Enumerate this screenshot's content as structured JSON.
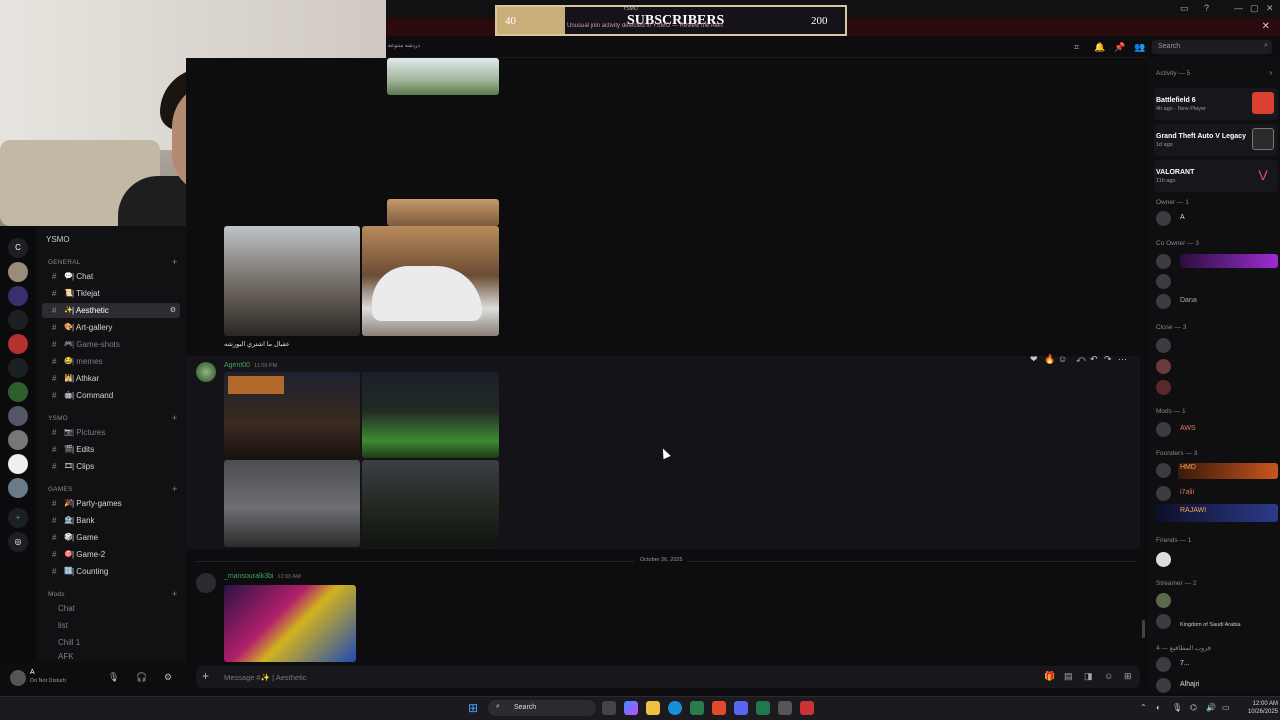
{
  "overlay": {
    "left_value": "40",
    "title": "SUBSCRIBERS",
    "right_value": "200",
    "subtitle": "Unusual join activity detected in YSMO — Review the Alert",
    "top_label": "YSMO"
  },
  "header": {
    "breadcrumb": "دردشة متنوعة",
    "search_placeholder": "Search"
  },
  "rail": {
    "home_letter": "C"
  },
  "server": {
    "name": "YSMO"
  },
  "categories": [
    {
      "label": "GENERAL"
    },
    {
      "label": "YSMO"
    },
    {
      "label": "GAMES"
    },
    {
      "label": "Mods"
    }
  ],
  "channels": [
    {
      "label": "| Chat",
      "emoji": "💬",
      "muted": false
    },
    {
      "label": "| Tklejat",
      "emoji": "📜",
      "muted": false
    },
    {
      "label": "| Aesthetic",
      "emoji": "✨",
      "muted": false,
      "active": true
    },
    {
      "label": "| Art-gallery",
      "emoji": "🎨",
      "muted": false
    },
    {
      "label": "| Game-shots",
      "emoji": "🎮",
      "muted": true
    },
    {
      "label": "| memes",
      "emoji": "😂",
      "muted": true
    },
    {
      "label": "| Athkar",
      "emoji": "🕌",
      "muted": false
    },
    {
      "label": "| Command",
      "emoji": "🤖",
      "muted": false
    },
    {
      "label": "| Pictures",
      "emoji": "📷",
      "muted": true
    },
    {
      "label": "| Edits",
      "emoji": "🎬",
      "muted": false
    },
    {
      "label": "| Clips",
      "emoji": "🎞",
      "muted": false
    },
    {
      "label": "| Party-games",
      "emoji": "🎉",
      "muted": false
    },
    {
      "label": "| Bank",
      "emoji": "🏦",
      "muted": false
    },
    {
      "label": "| Game",
      "emoji": "🎲",
      "muted": false
    },
    {
      "label": "| Game-2",
      "emoji": "🎯",
      "muted": false
    },
    {
      "label": "| Counting",
      "emoji": "🔢",
      "muted": false
    },
    {
      "label": "Chat",
      "emoji": "",
      "muted": true
    },
    {
      "label": "list",
      "emoji": "",
      "muted": true
    },
    {
      "label": "Chill 1",
      "emoji": "",
      "muted": true
    },
    {
      "label": "AFK",
      "emoji": "",
      "muted": true
    }
  ],
  "user": {
    "name": "A",
    "status": "Do Not Disturb"
  },
  "messages": [
    {
      "caption": "عقبال ما اشتري البورشه"
    },
    {
      "author": "Agent00",
      "time": "11:09 PM",
      "author_color": "#3ba55d"
    },
    {
      "author": "_mansouralk3bi",
      "time": "12:00 AM",
      "author_color": "#3ba55d"
    }
  ],
  "date_separator": "October 26, 2025",
  "composer": {
    "placeholder": "Message #✨ | Aesthetic"
  },
  "members": {
    "activity_header": "Activity — 5",
    "activities": [
      {
        "game": "Battlefield 6",
        "sub": "4h ago · New Player",
        "color": "#d9412e"
      },
      {
        "game": "Grand Theft Auto V Legacy",
        "sub": "1d ago",
        "color": "#2b2b2b"
      },
      {
        "game": "VALORANT",
        "sub": "11h ago",
        "color": "#ff4655"
      }
    ],
    "sections": [
      {
        "title": "Owner — 1",
        "names": [
          "A"
        ]
      },
      {
        "title": "Co Owner — 3",
        "names": [
          "",
          "",
          "Dana"
        ]
      },
      {
        "title": "Close — 3",
        "names": [
          "",
          "",
          ""
        ]
      },
      {
        "title": "Mods — 1",
        "names": [
          "AWS"
        ]
      },
      {
        "title": "Founders — 3",
        "names": [
          "HMD",
          "i7alii",
          "RAJAWI"
        ]
      },
      {
        "title": "Friends — 1",
        "names": [
          ""
        ]
      },
      {
        "title": "Streamer — 2",
        "names": [
          "",
          "Kingdom of Saudi Arabia"
        ]
      },
      {
        "title": "4 — قروب المطافيع",
        "names": [
          "7...",
          "Alhajri"
        ]
      }
    ]
  },
  "taskbar": {
    "search_label": "Search",
    "time": "12:00 AM",
    "date": "10/26/2025"
  }
}
